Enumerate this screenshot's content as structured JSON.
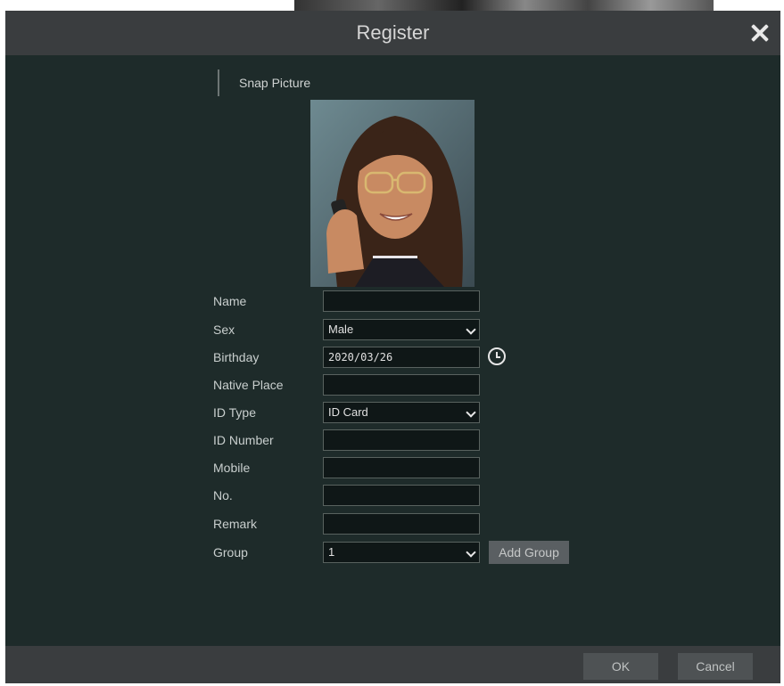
{
  "window": {
    "title": "Register"
  },
  "section": {
    "label": "Snap Picture"
  },
  "form": {
    "fields": [
      {
        "label": "Name",
        "value": ""
      },
      {
        "label": "Sex",
        "value": "Male"
      },
      {
        "label": "Birthday",
        "value": "2020/03/26"
      },
      {
        "label": "Native Place",
        "value": ""
      },
      {
        "label": "ID Type",
        "value": "ID Card"
      },
      {
        "label": "ID Number",
        "value": ""
      },
      {
        "label": "Mobile",
        "value": ""
      },
      {
        "label": "No.",
        "value": ""
      },
      {
        "label": "Remark",
        "value": ""
      },
      {
        "label": "Group",
        "value": "1"
      }
    ],
    "add_group_label": "Add Group"
  },
  "footer": {
    "ok_label": "OK",
    "cancel_label": "Cancel"
  },
  "icons": {
    "close": "close-icon",
    "calendar": "clock-icon",
    "dropdown": "chevron-down-icon"
  }
}
